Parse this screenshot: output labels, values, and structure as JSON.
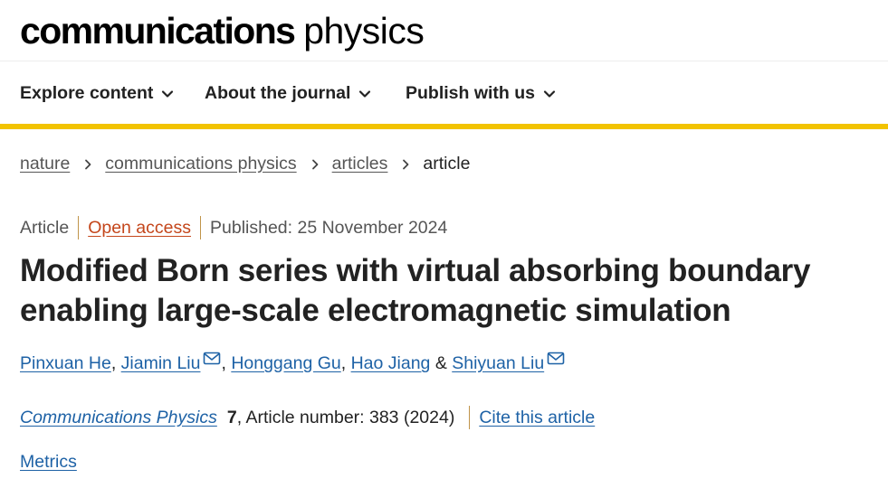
{
  "header": {
    "logo_bold": "communications",
    "logo_light": "physics"
  },
  "nav": {
    "items": [
      {
        "label": "Explore content"
      },
      {
        "label": "About the journal"
      },
      {
        "label": "Publish with us"
      }
    ]
  },
  "breadcrumb": {
    "items": [
      "nature",
      "communications physics",
      "articles"
    ],
    "current": "article"
  },
  "article": {
    "type": "Article",
    "access": "Open access",
    "published": "Published: 25 November 2024",
    "title": "Modified Born series with virtual absorbing boundary enabling large-scale electromagnetic simulation",
    "authors": [
      {
        "name": "Pinxuan He",
        "sep": ", "
      },
      {
        "name": "Jiamin Liu",
        "sep": ", "
      },
      {
        "name": "Honggang Gu",
        "sep": ", "
      },
      {
        "name": "Hao Jiang",
        "sep": " & "
      },
      {
        "name": "Shiyuan Liu",
        "sep": ""
      }
    ],
    "journal_name": "Communications Physics",
    "volume": "7",
    "article_number_text": ", Article number: 383 (2024)",
    "cite_label": "Cite this article",
    "metrics_label": "Metrics"
  },
  "colors": {
    "accent_bar": "#f2c300",
    "link": "#1e62a6",
    "open_access": "#c4461b"
  },
  "icons": {
    "nav_chevron": "chevron-down-icon",
    "breadcrumb_sep": "chevron-right-icon",
    "email": "mail-icon"
  }
}
